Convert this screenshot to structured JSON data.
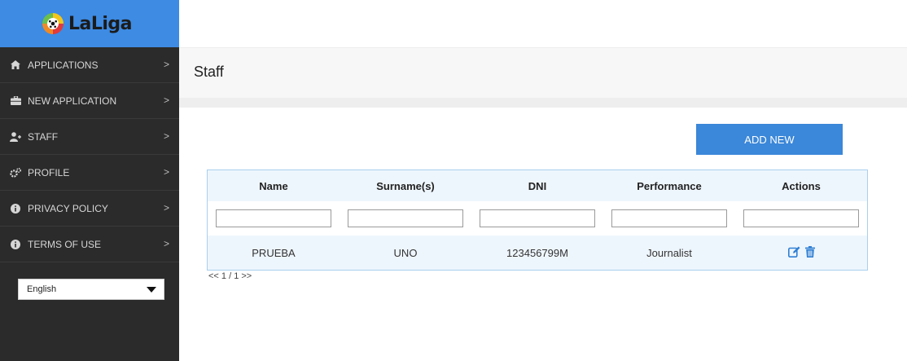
{
  "brand": {
    "logo_text": "LaLiga"
  },
  "sidebar": {
    "items": [
      {
        "label": "APPLICATIONS",
        "icon": "home-icon"
      },
      {
        "label": "NEW APPLICATION",
        "icon": "briefcase-icon"
      },
      {
        "label": "STAFF",
        "icon": "add-user-icon"
      },
      {
        "label": "PROFILE",
        "icon": "cogs-icon"
      },
      {
        "label": "PRIVACY POLICY",
        "icon": "info-icon"
      },
      {
        "label": "TERMS OF USE",
        "icon": "info-icon"
      }
    ],
    "chevron": ">",
    "language": {
      "selected": "English"
    }
  },
  "page": {
    "title": "Staff",
    "add_button": "ADD NEW"
  },
  "table": {
    "columns": [
      "Name",
      "Surname(s)",
      "DNI",
      "Performance",
      "Actions"
    ],
    "rows": [
      {
        "name": "PRUEBA",
        "surname": "UNO",
        "dni": "123456799M",
        "performance": "Journalist"
      }
    ],
    "action_icons": [
      "edit-icon",
      "trash-icon"
    ],
    "pager": "<< 1 / 1 >>"
  },
  "colors": {
    "sidebar_bg": "#2b2b2b",
    "brand_blue": "#3d8be3",
    "button_blue": "#3b87d9",
    "table_border": "#a9cfee",
    "icon_blue": "#2f7fd4"
  }
}
